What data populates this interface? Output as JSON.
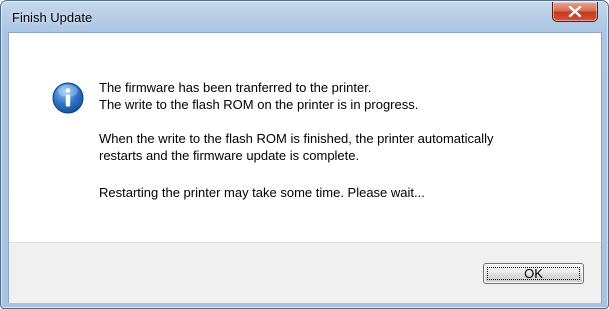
{
  "window": {
    "title": "Finish Update",
    "close_icon": "close-x-icon"
  },
  "message": {
    "icon": "info-icon",
    "line1": "The firmware has been tranferred to the printer.",
    "line2": "The write to the flash ROM on the printer is in progress.",
    "line3": "When the write to the flash ROM is finished, the printer automatically",
    "line4": "restarts and the firmware update is complete.",
    "line5": "Restarting the printer may take some time. Please wait..."
  },
  "buttons": {
    "ok_label": "OK"
  },
  "colors": {
    "frame_blue": "#a9c5e3",
    "close_red": "#c4391d",
    "info_blue": "#1e5fb4",
    "footer_gray": "#f0f0f0"
  }
}
